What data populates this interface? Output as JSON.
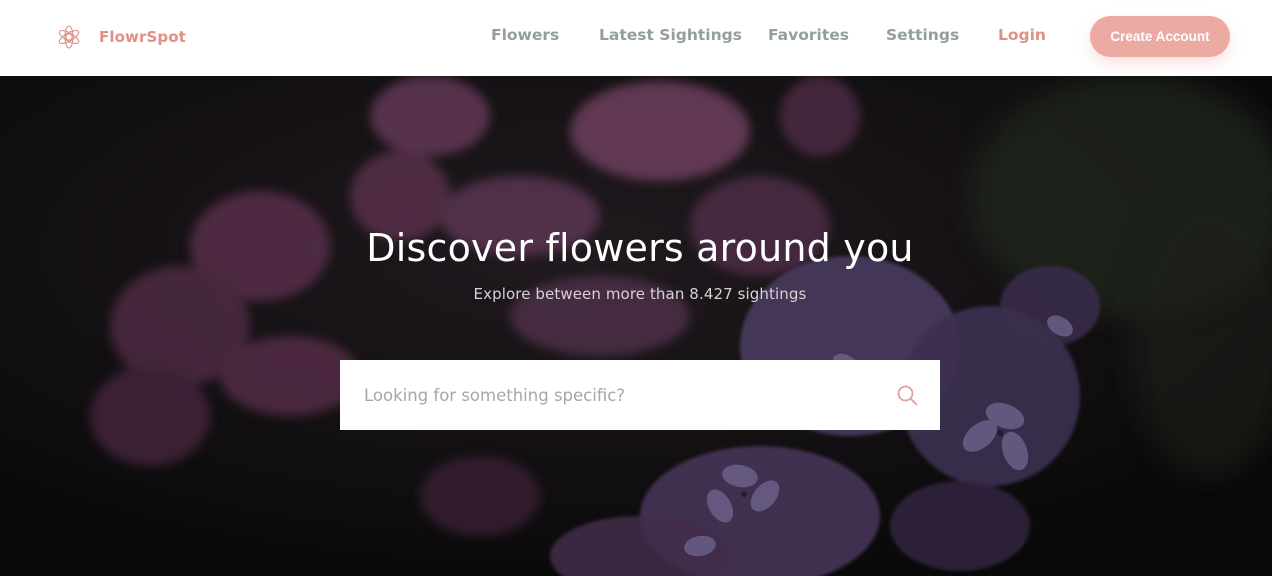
{
  "brand": {
    "name": "FlowrSpot",
    "logo_icon": "flower-logo-icon",
    "color": "#df9186"
  },
  "nav": {
    "items": [
      {
        "label": "Flowers"
      },
      {
        "label": "Latest Sightings"
      },
      {
        "label": "Favorites"
      },
      {
        "label": "Settings"
      }
    ],
    "login_label": "Login",
    "create_account_label": "Create Account"
  },
  "hero": {
    "title": "Discover flowers around you",
    "subtitle": "Explore between more than 8.427 sightings",
    "background": "dark lilac flowers photo"
  },
  "search": {
    "placeholder": "Looking for something specific?",
    "value": "",
    "icon": "search-icon"
  },
  "colors": {
    "accent": "#df9186",
    "button_bg": "#ecaba2",
    "nav_text": "#949ea0"
  }
}
